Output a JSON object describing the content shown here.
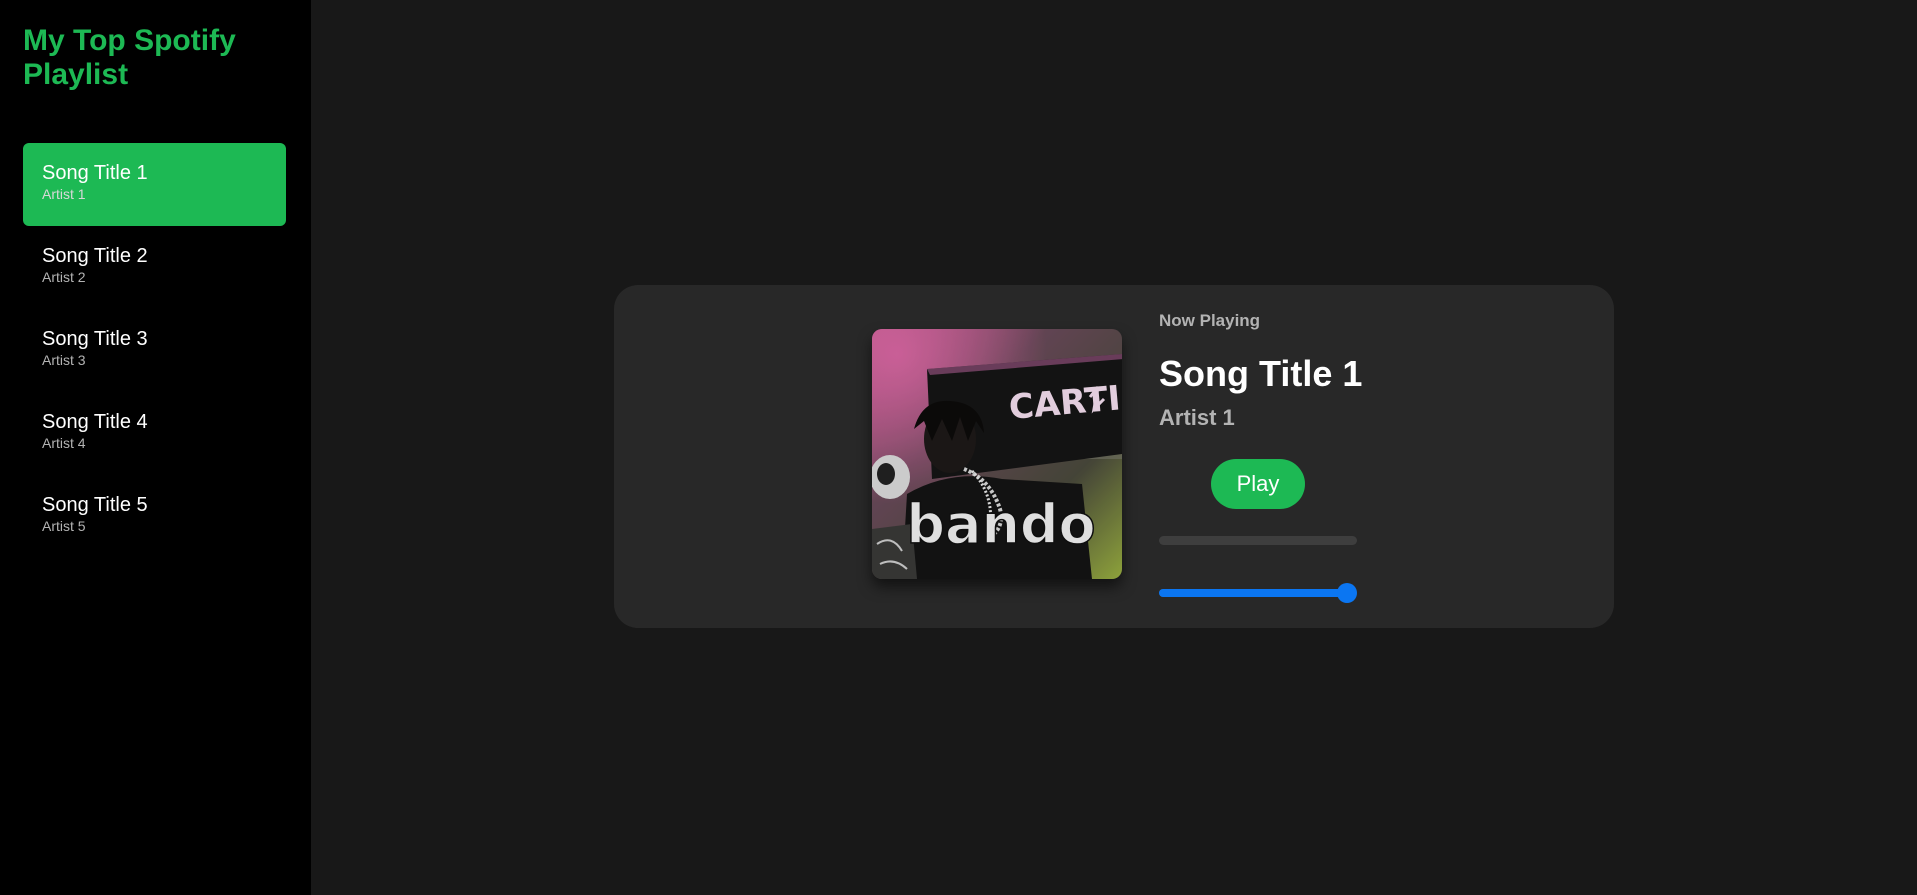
{
  "sidebar": {
    "title": "My Top Spotify Playlist",
    "songs": [
      {
        "title": "Song Title 1",
        "artist": "Artist 1",
        "active": true
      },
      {
        "title": "Song Title 2",
        "artist": "Artist 2",
        "active": false
      },
      {
        "title": "Song Title 3",
        "artist": "Artist 3",
        "active": false
      },
      {
        "title": "Song Title 4",
        "artist": "Artist 4",
        "active": false
      },
      {
        "title": "Song Title 5",
        "artist": "Artist 5",
        "active": false
      }
    ]
  },
  "player": {
    "now_playing_label": "Now Playing",
    "title": "Song Title 1",
    "artist": "Artist 1",
    "play_label": "Play",
    "progress_fraction": 0.0,
    "volume_fraction": 0.95,
    "album_art_text": [
      "bando",
      "CARTI"
    ]
  },
  "colors": {
    "accent": "#1db954",
    "sidebar_bg": "#000000",
    "main_bg": "#181818",
    "card_bg": "#282828",
    "slider_blue": "#0b76f2",
    "secondary_text": "#b3b3b3"
  },
  "icons": {
    "album_art": "album-cover-image"
  }
}
